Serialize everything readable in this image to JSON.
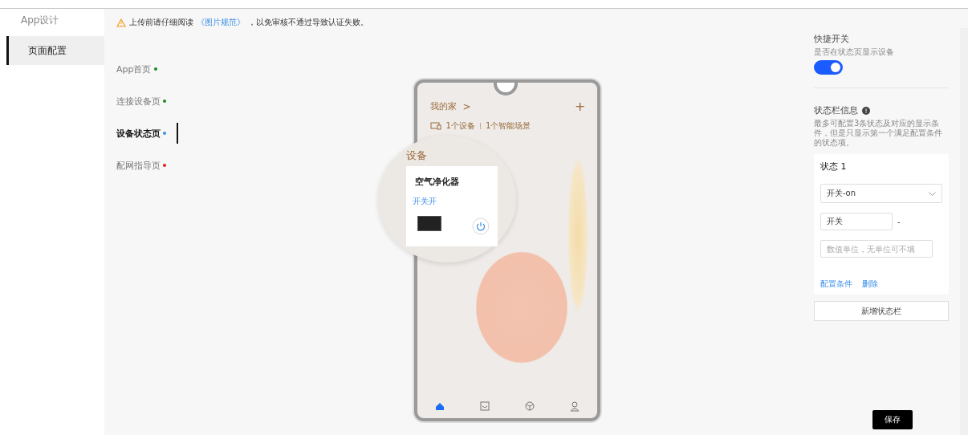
{
  "sidebar": {
    "title": "App设计",
    "items": [
      {
        "label": "页面配置",
        "selected": true
      }
    ]
  },
  "notice": {
    "before": "上传前请仔细阅读",
    "link": "《图片规范》",
    "after": "，以免审核不通过导致认证失败。"
  },
  "pages": [
    {
      "label": "App首页",
      "selected": false,
      "color": "#1a8a1a"
    },
    {
      "label": "连接设备页",
      "selected": false,
      "color": "#1a8a1a"
    },
    {
      "label": "设备状态页",
      "selected": true,
      "color": "#3a8ee6"
    },
    {
      "label": "配网指导页",
      "selected": false,
      "color": "#e02020"
    }
  ],
  "phone": {
    "home_title": "我的家",
    "home_chevron": ">",
    "add": "+",
    "devices": "1个设备",
    "scenes": "1个智能场景",
    "section": "设备",
    "device_name": "空气净化器",
    "device_status": "开关开",
    "tabs": [
      {
        "kind": "home",
        "selected": true
      },
      {
        "kind": "mall",
        "selected": false
      },
      {
        "kind": "smart",
        "selected": false
      },
      {
        "kind": "me",
        "selected": false
      }
    ]
  },
  "quick_switch": {
    "title": "快捷开关",
    "description": "是否在状态页显示设备",
    "on": true
  },
  "status_bar": {
    "title": "状态栏信息",
    "description": "最多可配置3条状态及对应的显示条件，但是只显示第一个满足配置条件的状态项。",
    "items": [
      {
        "title": "状态 1",
        "select": "开关-on",
        "name_value": "开关",
        "separator": "-",
        "unit_placeholder": "数值单位，无单位可不填",
        "links": [
          "配置条件",
          "删除"
        ]
      }
    ],
    "add_button": "新增状态栏"
  },
  "save_button": "保存"
}
